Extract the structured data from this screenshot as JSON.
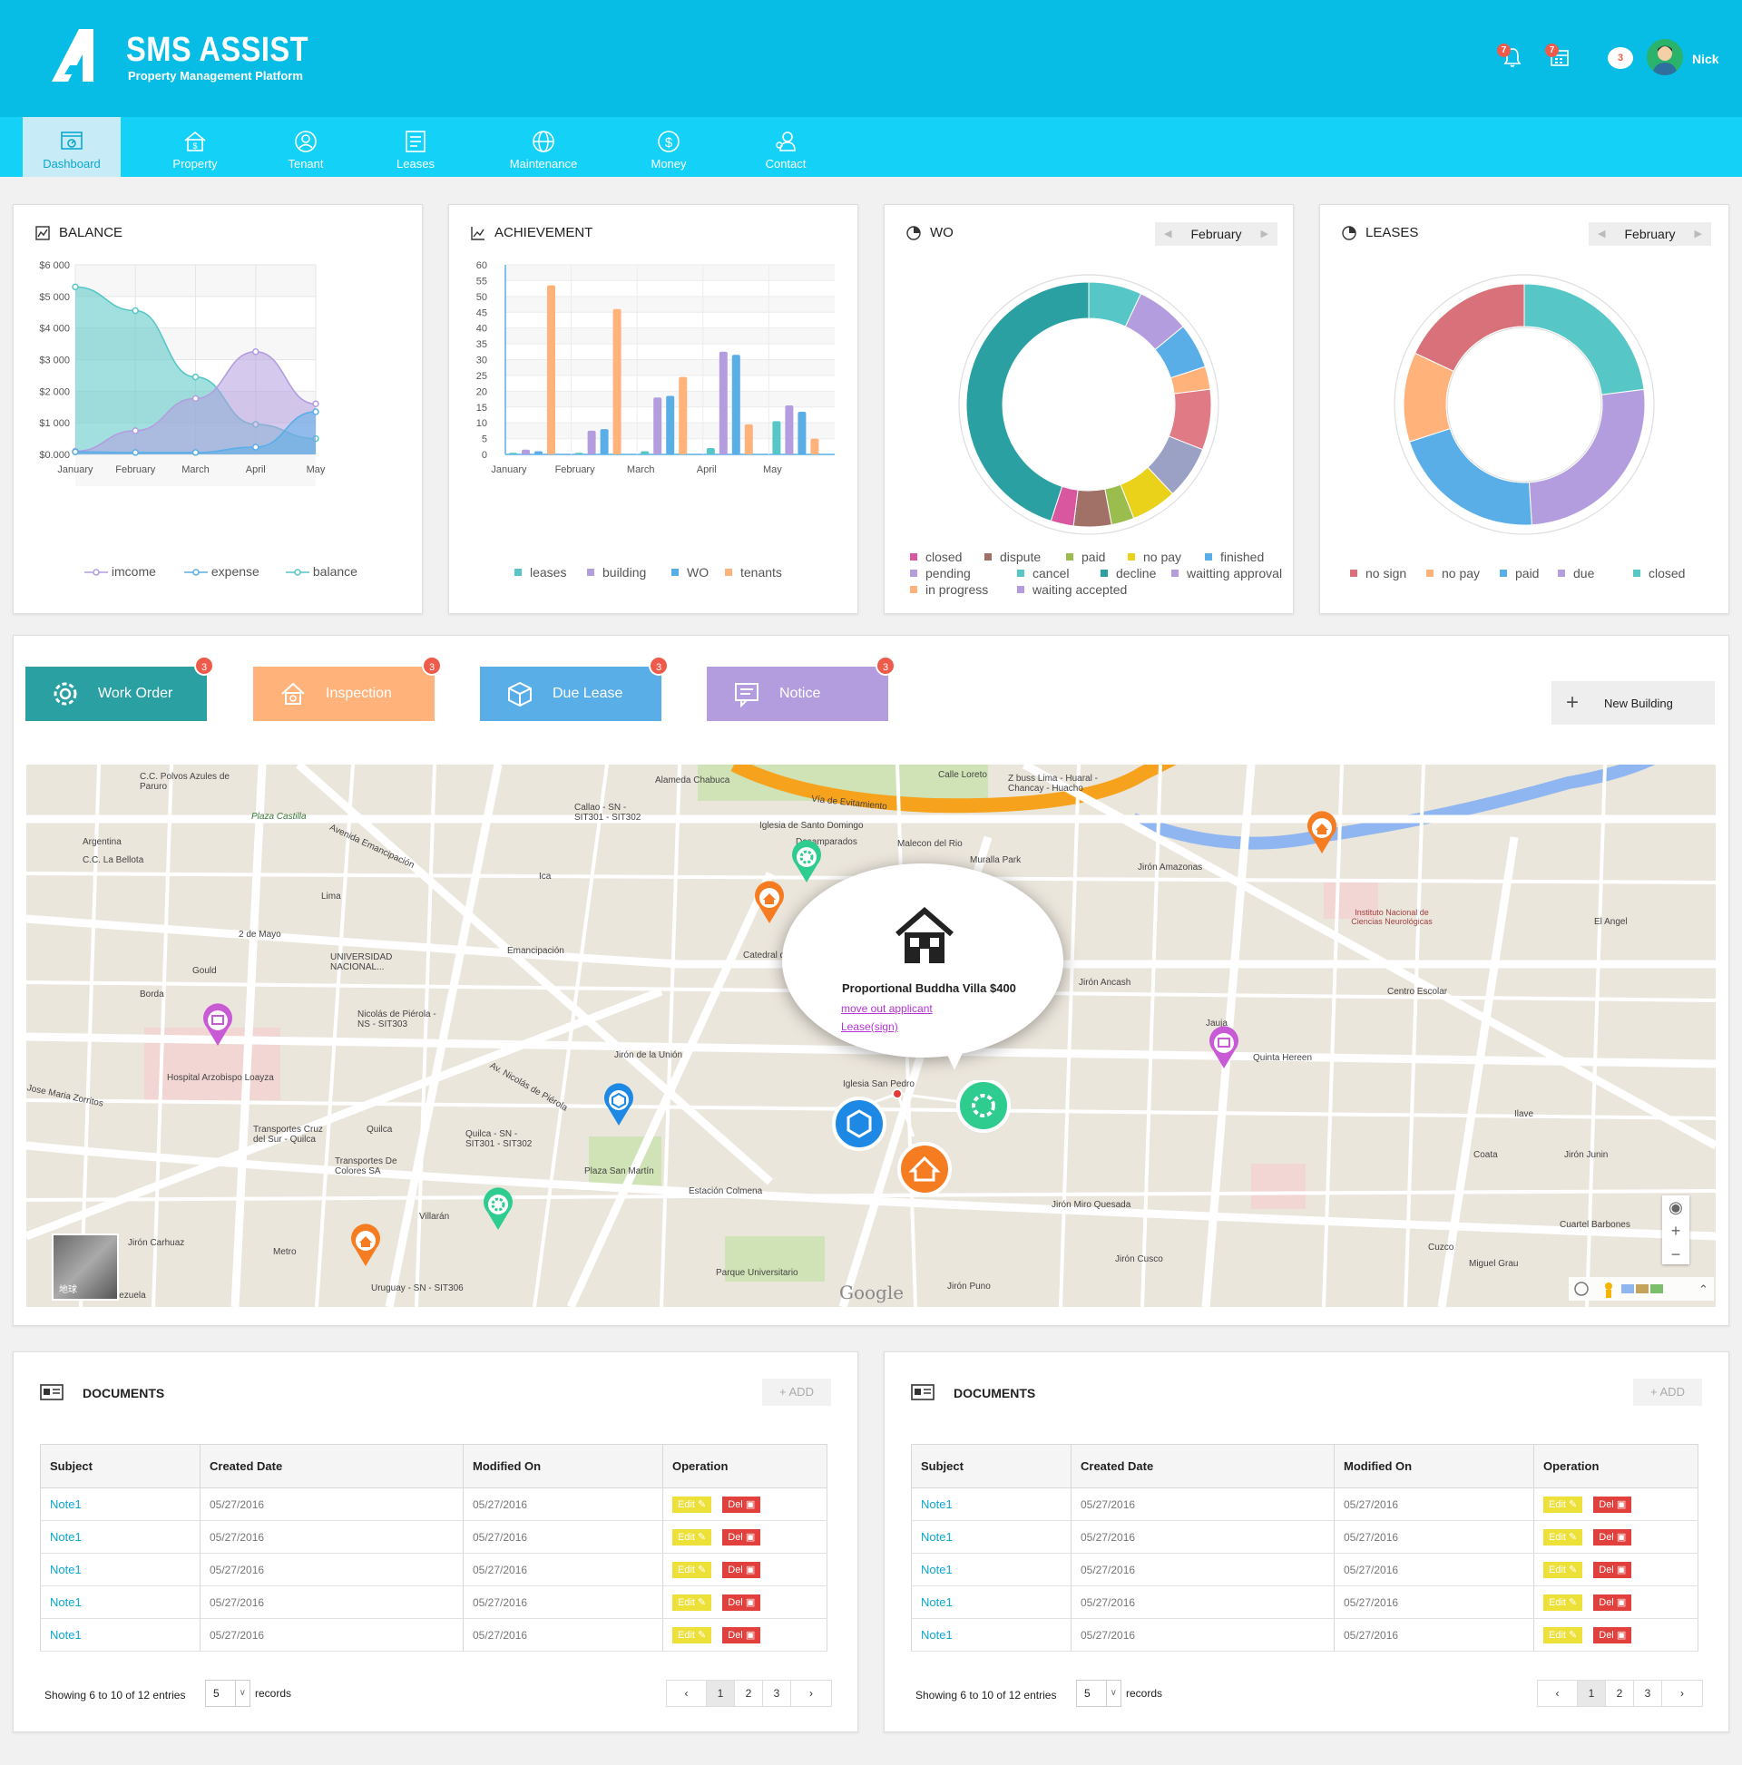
{
  "header": {
    "app_name": "SMS ASSIST",
    "app_subtitle": "Property Management Platform",
    "notifications_count": "7",
    "calendar_count": "7",
    "messages_count": "3",
    "user_name": "Nick"
  },
  "nav": [
    {
      "label": "Dashboard",
      "icon": "dashboard-icon",
      "active": true
    },
    {
      "label": "Property",
      "icon": "property-icon"
    },
    {
      "label": "Tenant",
      "icon": "tenant-icon"
    },
    {
      "label": "Leases",
      "icon": "leases-icon"
    },
    {
      "label": "Maintenance",
      "icon": "maintenance-icon"
    },
    {
      "label": "Money",
      "icon": "money-icon"
    },
    {
      "label": "Contact",
      "icon": "contact-icon"
    }
  ],
  "balance": {
    "title": "BALANCE",
    "chart_data": {
      "type": "area",
      "categories": [
        "January",
        "February",
        "March",
        "April",
        "May"
      ],
      "y_tick_labels": [
        "$6 000",
        "$5 000",
        "$4 000",
        "$3 000",
        "$2 000",
        "$1 000",
        "$0.000"
      ],
      "ylim": [
        0,
        6000
      ],
      "series": [
        {
          "name": "imcome",
          "color": "#b39ddf",
          "values": [
            100,
            750,
            1770,
            3250,
            1600
          ]
        },
        {
          "name": "expense",
          "color": "#5aaee8",
          "values": [
            80,
            60,
            60,
            230,
            1350
          ]
        },
        {
          "name": "balance",
          "color": "#56c7c6",
          "values": [
            5300,
            4550,
            2450,
            950,
            500
          ]
        }
      ]
    }
  },
  "achievement": {
    "title": "ACHIEVEMENT",
    "chart_data": {
      "type": "bar",
      "categories": [
        "January",
        "February",
        "March",
        "April",
        "May"
      ],
      "y_tick_labels": [
        "60",
        "55",
        "50",
        "45",
        "40",
        "35",
        "30",
        "25",
        "20",
        "15",
        "10",
        "5",
        "0"
      ],
      "ylim": [
        0,
        60
      ],
      "series": [
        {
          "name": "leases",
          "color": "#56c7c6",
          "values": [
            0.5,
            0.5,
            1,
            2,
            10.5
          ]
        },
        {
          "name": "building",
          "color": "#b39ddf",
          "values": [
            1.5,
            7.5,
            18,
            32.5,
            15.5
          ]
        },
        {
          "name": "WO",
          "color": "#5aaee8",
          "values": [
            1,
            8,
            18.5,
            31.5,
            13.5
          ]
        },
        {
          "name": "tenants",
          "color": "#ffb27a",
          "values": [
            53.5,
            46,
            24.5,
            9.5,
            5
          ]
        }
      ]
    }
  },
  "wo": {
    "title": "WO",
    "month": "February",
    "chart_data": {
      "type": "pie",
      "labels": [
        "finished",
        "waitting approval",
        "no pay",
        "in progress",
        "closed",
        "dispute",
        "paid",
        "no pay",
        "decline",
        "closed",
        "dispute",
        "cancel"
      ],
      "slices": [
        {
          "name": "cancel",
          "color": "#56c7c6",
          "value": 7
        },
        {
          "name": "waitting approval",
          "color": "#b39ddf",
          "value": 7
        },
        {
          "name": "finished",
          "color": "#5aaee8",
          "value": 6
        },
        {
          "name": "no pay",
          "color": "#ffb27a",
          "value": 3
        },
        {
          "name": "closed",
          "color": "#e07b85",
          "value": 8
        },
        {
          "name": "in progress",
          "color": "#9aa1c4",
          "value": 7
        },
        {
          "name": "no pay",
          "color": "#ead21a",
          "value": 6
        },
        {
          "name": "paid",
          "color": "#9bbd4d",
          "value": 3
        },
        {
          "name": "dispute",
          "color": "#a17067",
          "value": 5
        },
        {
          "name": "closed",
          "color": "#d9579f",
          "value": 3
        },
        {
          "name": "decline",
          "color": "#2aa0a2",
          "value": 45
        }
      ],
      "legend": [
        {
          "name": "closed",
          "color": "#d9579f"
        },
        {
          "name": "dispute",
          "color": "#a17067"
        },
        {
          "name": "paid",
          "color": "#9bbd4d"
        },
        {
          "name": "no pay",
          "color": "#ead21a"
        },
        {
          "name": "finished",
          "color": "#5aaee8"
        },
        {
          "name": "pending",
          "color": "#b39ddf"
        },
        {
          "name": "cancel",
          "color": "#56c7c6"
        },
        {
          "name": "decline",
          "color": "#2aa0a2"
        },
        {
          "name": "waitting approval",
          "color": "#b39ddf"
        },
        {
          "name": "in progress",
          "color": "#ffb27a"
        },
        {
          "name": "waiting accepted",
          "color": "#b39ddf"
        }
      ]
    }
  },
  "leases": {
    "title": "LEASES",
    "month": "February",
    "chart_data": {
      "type": "pie",
      "slices": [
        {
          "name": "closed",
          "color": "#56c7c6",
          "value": 23
        },
        {
          "name": "due",
          "color": "#b39ddf",
          "value": 26
        },
        {
          "name": "paid",
          "color": "#5aaee8",
          "value": 21
        },
        {
          "name": "no pay",
          "color": "#ffb27a",
          "value": 12
        },
        {
          "name": "no sign",
          "color": "#d9717a",
          "value": 18
        }
      ],
      "legend": [
        {
          "name": "no sign",
          "color": "#d9717a"
        },
        {
          "name": "no pay",
          "color": "#ffb27a"
        },
        {
          "name": "paid",
          "color": "#5aaee8"
        },
        {
          "name": "due",
          "color": "#b39ddf"
        },
        {
          "name": "closed",
          "color": "#56c7c6"
        }
      ]
    }
  },
  "quick_buttons": [
    {
      "label": "Work Order",
      "count": "3",
      "color": "#2aa0a2",
      "icon": "gear-icon"
    },
    {
      "label": "Inspection",
      "count": "3",
      "color": "#ffb27a",
      "icon": "house-icon"
    },
    {
      "label": "Due Lease",
      "count": "3",
      "color": "#5aaee8",
      "icon": "cube-icon"
    },
    {
      "label": "Notice",
      "count": "3",
      "color": "#b39ddf",
      "icon": "message-icon"
    }
  ],
  "new_building_label": "New Building",
  "map": {
    "popup_title": "Proportional Buddha Villa $400",
    "popup_link_1": "move out applicant",
    "popup_link_2": "Lease(sign)",
    "satellite_label": "地球",
    "google_label": "Google",
    "street_labels": [
      "Jirón Amazonas",
      "Vía de Evitamiento",
      "Avenida Emancipación",
      "Av. Nicolás de Piérola",
      "Jirón Junin",
      "Jirón Ancash",
      "Jirón Miro Quesada",
      "Centro Escolar",
      "Jirón Cusco",
      "Jirón Puno",
      "Plaza San Martín",
      "Estación Colmena",
      "Parque Universitario",
      "Hospital Arzobispo Loayza",
      "Uruguay - SN - SIT306",
      "Calle Loreto",
      "Alameda Chabuca",
      "Malecon del Rio",
      "Muralla Park",
      "Iglesia de Santo Domingo",
      "Catedral de Lima",
      "Iglesia San Pedro",
      "Quinta Hereen",
      "El Angel",
      "Miguel Grau",
      "Cuartel Barbones",
      "Instituto Nacional de Ciencias Neurológicas",
      "Plaza Castilla",
      "C.C. La Bellota",
      "Argentina",
      "Borda",
      "Gould",
      "2 de Mayo",
      "Lima",
      "Ica",
      "Emancipación",
      "Jirón de la Unión",
      "UNIVERSIDAD NACIONAL...",
      "Transportes Cruz del Sur - Quilca",
      "Transportes De Colores SA",
      "Quilca",
      "Villarán",
      "Metro",
      "Venezuela",
      "Jirón Carhuaz",
      "Cuzco",
      "Coata",
      "Ilave",
      "Jauja",
      "Jose Maria Zorritos",
      "Quilca - SN - SIT301 - SIT302",
      "Callao - SN - SIT301 - SIT302",
      "Nicolás de Piérola - NS - SIT303",
      "C.C. Polvos Azules de Paruro",
      "Z buss Lima - Huaral - Chancay - Huacho",
      "Desamparados"
    ]
  },
  "documents": [
    {
      "title": "DOCUMENTS",
      "add_label": "ADD",
      "columns": [
        "Subject",
        "Created Date",
        "Modified On",
        "Operation"
      ],
      "rows": [
        [
          "Note1",
          "05/27/2016",
          "05/27/2016"
        ],
        [
          "Note1",
          "05/27/2016",
          "05/27/2016"
        ],
        [
          "Note1",
          "05/27/2016",
          "05/27/2016"
        ],
        [
          "Note1",
          "05/27/2016",
          "05/27/2016"
        ],
        [
          "Note1",
          "05/27/2016",
          "05/27/2016"
        ]
      ],
      "edit_label": "Edit",
      "del_label": "Del",
      "showing": "Showing 6 to 10 of 12 entries",
      "per_page": "5",
      "records_label": "records",
      "pages": [
        "‹",
        "1",
        "2",
        "3",
        "›"
      ]
    },
    {
      "title": "DOCUMENTS",
      "add_label": "ADD",
      "columns": [
        "Subject",
        "Created Date",
        "Modified On",
        "Operation"
      ],
      "rows": [
        [
          "Note1",
          "05/27/2016",
          "05/27/2016"
        ],
        [
          "Note1",
          "05/27/2016",
          "05/27/2016"
        ],
        [
          "Note1",
          "05/27/2016",
          "05/27/2016"
        ],
        [
          "Note1",
          "05/27/2016",
          "05/27/2016"
        ],
        [
          "Note1",
          "05/27/2016",
          "05/27/2016"
        ]
      ],
      "edit_label": "Edit",
      "del_label": "Del",
      "showing": "Showing 6 to 10 of 12 entries",
      "per_page": "5",
      "records_label": "records",
      "pages": [
        "‹",
        "1",
        "2",
        "3",
        "›"
      ]
    }
  ]
}
